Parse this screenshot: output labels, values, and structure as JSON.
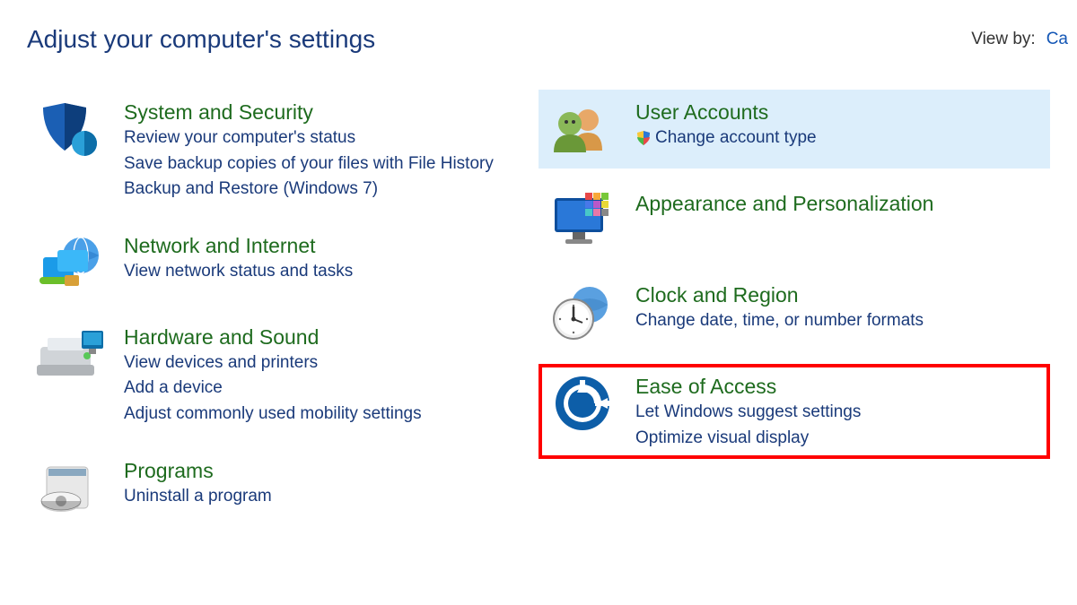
{
  "header": {
    "title": "Adjust your computer's settings",
    "view_by_label": "View by:",
    "view_by_value": "Ca"
  },
  "left": [
    {
      "icon": "shield",
      "title": "System and Security",
      "links": [
        {
          "label": "Review your computer's status"
        },
        {
          "label": "Save backup copies of your files with File History"
        },
        {
          "label": "Backup and Restore (Windows 7)"
        }
      ]
    },
    {
      "icon": "network",
      "title": "Network and Internet",
      "links": [
        {
          "label": "View network status and tasks"
        }
      ]
    },
    {
      "icon": "hardware",
      "title": "Hardware and Sound",
      "links": [
        {
          "label": "View devices and printers"
        },
        {
          "label": "Add a device"
        },
        {
          "label": "Adjust commonly used mobility settings"
        }
      ]
    },
    {
      "icon": "programs",
      "title": "Programs",
      "links": [
        {
          "label": "Uninstall a program"
        }
      ]
    }
  ],
  "right": [
    {
      "icon": "users",
      "title": "User Accounts",
      "selected": true,
      "links": [
        {
          "label": "Change account type",
          "shield": true
        }
      ]
    },
    {
      "icon": "appearance",
      "title": "Appearance and Personalization",
      "links": []
    },
    {
      "icon": "clock",
      "title": "Clock and Region",
      "links": [
        {
          "label": "Change date, time, or number formats"
        }
      ]
    },
    {
      "icon": "ease",
      "title": "Ease of Access",
      "highlight": true,
      "links": [
        {
          "label": "Let Windows suggest settings"
        },
        {
          "label": "Optimize visual display"
        }
      ]
    }
  ]
}
